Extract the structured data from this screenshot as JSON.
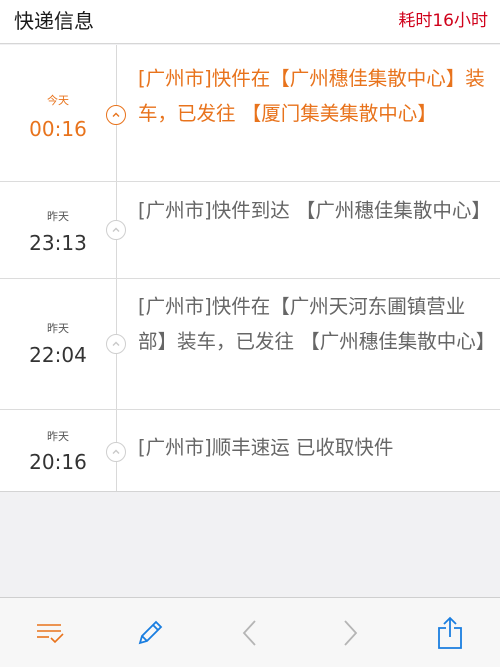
{
  "header": {
    "title": "快递信息",
    "elapsed": "耗时16小时"
  },
  "events": [
    {
      "day": "今天",
      "time": "00:16",
      "text": "[广州市]快件在【广州穗佳集散中心】装车，已发往 【厦门集美集散中心】",
      "active": true
    },
    {
      "day": "昨天",
      "time": "23:13",
      "text": "[广州市]快件到达 【广州穗佳集散中心】",
      "active": false
    },
    {
      "day": "昨天",
      "time": "22:04",
      "text": "[广州市]快件在【广州天河东圃镇营业部】装车，已发往 【广州穗佳集散中心】",
      "active": false
    },
    {
      "day": "昨天",
      "time": "20:16",
      "text": "[广州市]顺丰速运 已收取快件",
      "active": false
    }
  ],
  "toolbar": {
    "items": [
      "list-checklist-icon",
      "pencil-edit-icon",
      "chevron-left-icon",
      "chevron-right-icon",
      "share-icon"
    ]
  },
  "colors": {
    "accent": "#e8731c",
    "elapsed": "#d0021b",
    "toolbar_icon": "#1a7ee0"
  }
}
